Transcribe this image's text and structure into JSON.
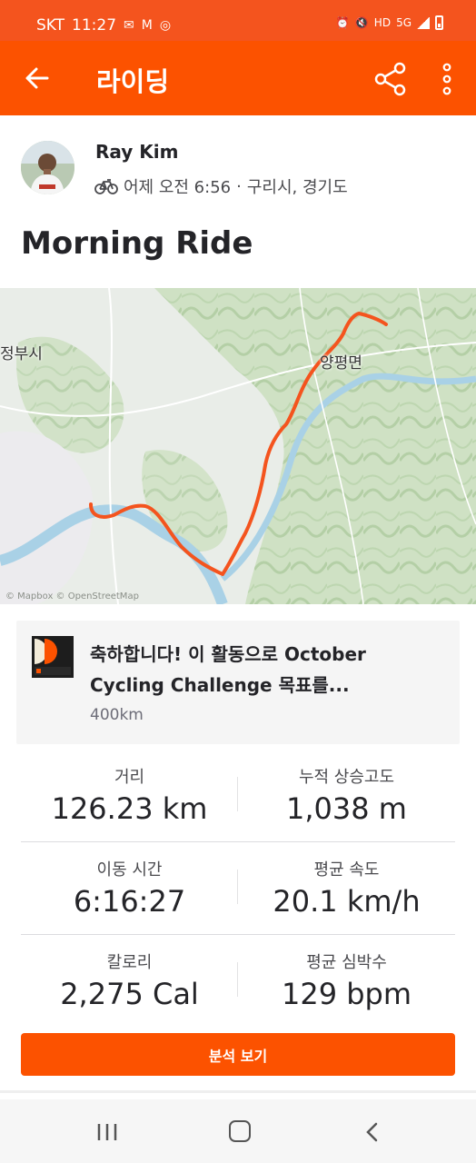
{
  "status_bar": {
    "carrier": "SKT",
    "time": "11:27",
    "left_icons": [
      "notification-icon",
      "gmail-icon",
      "whatsapp-icon"
    ],
    "right_icons": [
      "alarm-icon",
      "mute-icon",
      "hd-voice-icon",
      "5g-icon",
      "signal-icon",
      "battery-icon"
    ],
    "hd_label": "HD",
    "net_label": "5G"
  },
  "app_bar": {
    "title": "라이딩",
    "accent": "#fc5200"
  },
  "athlete": {
    "name": "Ray Kim",
    "when": "어제 오전 6:56",
    "separator": "·",
    "location": "구리시, 경기도",
    "activity_icon": "bike-icon"
  },
  "activity": {
    "title": "Morning Ride"
  },
  "map": {
    "labels": {
      "west": "정부시",
      "east": "양평면"
    },
    "attribution": "© Mapbox © OpenStreetMap",
    "route_color": "#f4541e"
  },
  "achievement": {
    "text": "축하합니다! 이 활동으로 October Cycling Challenge 목표를...",
    "subtext": "400km",
    "badge_label": "400"
  },
  "stats": [
    {
      "label": "거리",
      "value": "126.23 km"
    },
    {
      "label": "누적 상승고도",
      "value": "1,038 m"
    },
    {
      "label": "이동 시간",
      "value": "6:16:27"
    },
    {
      "label": "평균 속도",
      "value": "20.1 km/h"
    },
    {
      "label": "칼로리",
      "value": "2,275 Cal"
    },
    {
      "label": "평균 심박수",
      "value": "129 bpm"
    }
  ],
  "analysis_button": "분석 보기"
}
